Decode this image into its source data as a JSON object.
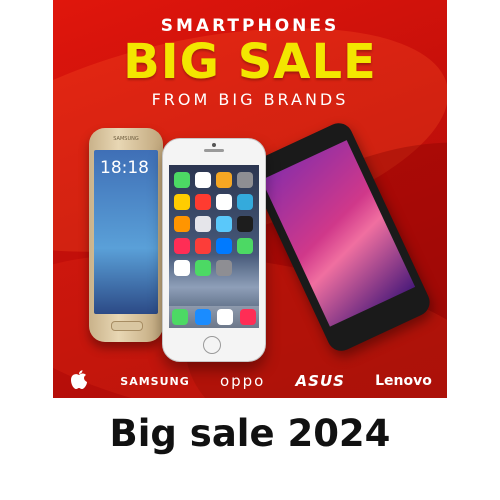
{
  "banner": {
    "top_text": "SMARTPHONES",
    "big_text": "BIG SALE",
    "sub_text": "FROM BIG BRANDS",
    "colors": {
      "background": "#d0120a",
      "headline": "#f3e600",
      "text": "#ffffff"
    }
  },
  "phones": {
    "samsung": {
      "brand": "SAMSUNG",
      "clock": "18:18"
    },
    "iphone": {},
    "asus": {}
  },
  "brands": [
    {
      "name": "apple-logo",
      "text": ""
    },
    {
      "name": "samsung-logo",
      "text": "SAMSUNG"
    },
    {
      "name": "oppo-logo",
      "text": "oppo"
    },
    {
      "name": "asus-logo",
      "text": "ASUS"
    },
    {
      "name": "lenovo-logo",
      "text": "Lenovo"
    }
  ],
  "caption": "Big sale 2024"
}
